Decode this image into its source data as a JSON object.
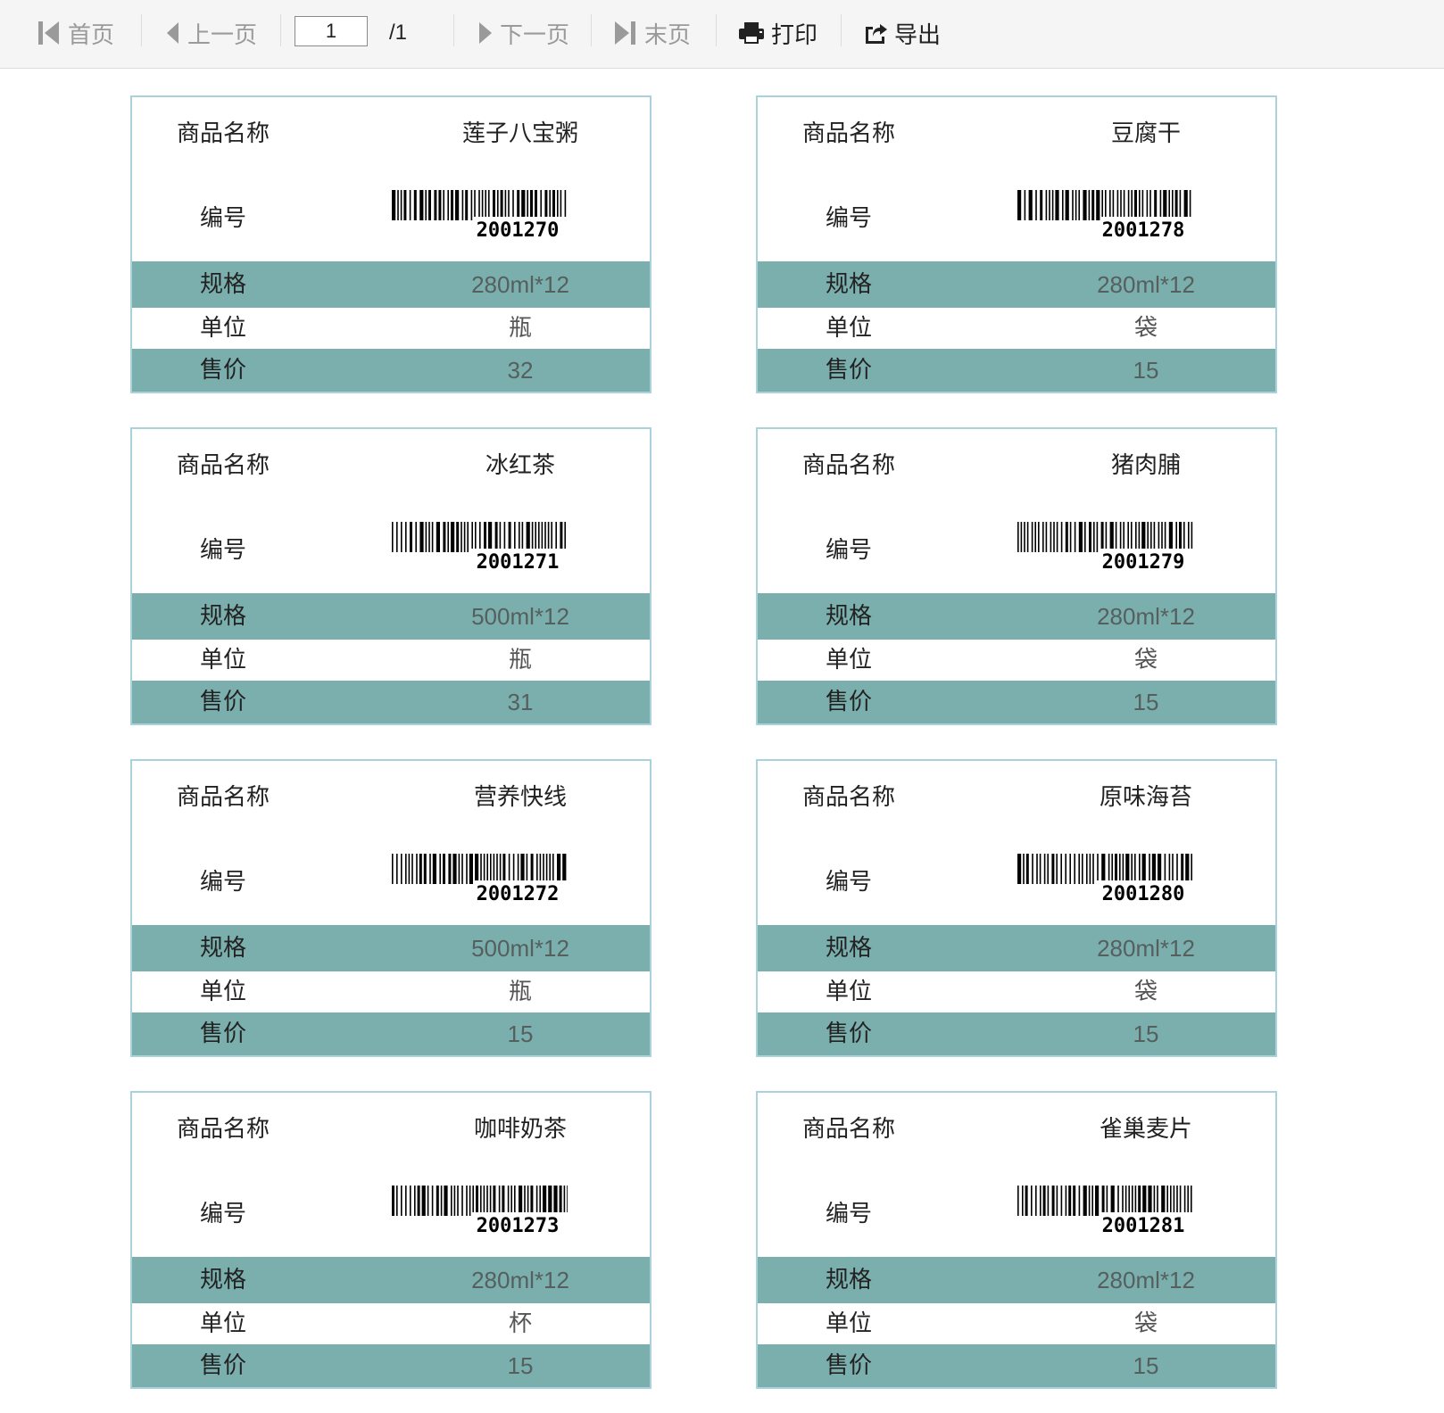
{
  "toolbar": {
    "first_label": "首页",
    "prev_label": "上一页",
    "page_value": "1",
    "page_total": "/1",
    "next_label": "下一页",
    "last_label": "末页",
    "print_label": "打印",
    "export_label": "导出",
    "icons": {
      "first": "first-page-icon",
      "prev": "prev-page-icon",
      "next": "next-page-icon",
      "last": "last-page-icon",
      "print": "printer-icon",
      "export": "export-icon"
    }
  },
  "labels": {
    "name": "商品名称",
    "code": "编号",
    "spec": "规格",
    "unit": "单位",
    "price": "售价"
  },
  "colors": {
    "stripe": "#7aafad",
    "card_border": "#a9d2dc",
    "disabled_text": "#9a9a9a"
  },
  "products": [
    {
      "name": "莲子八宝粥",
      "code": "2001270",
      "spec": "280ml*12",
      "unit": "瓶",
      "price": "32"
    },
    {
      "name": "豆腐干",
      "code": "2001278",
      "spec": "280ml*12",
      "unit": "袋",
      "price": "15"
    },
    {
      "name": "冰红茶",
      "code": "2001271",
      "spec": "500ml*12",
      "unit": "瓶",
      "price": "31"
    },
    {
      "name": "猪肉脯",
      "code": "2001279",
      "spec": "280ml*12",
      "unit": "袋",
      "price": "15"
    },
    {
      "name": "营养快线",
      "code": "2001272",
      "spec": "500ml*12",
      "unit": "瓶",
      "price": "15"
    },
    {
      "name": "原味海苔",
      "code": "2001280",
      "spec": "280ml*12",
      "unit": "袋",
      "price": "15"
    },
    {
      "name": "咖啡奶茶",
      "code": "2001273",
      "spec": "280ml*12",
      "unit": "杯",
      "price": "15"
    },
    {
      "name": "雀巢麦片",
      "code": "2001281",
      "spec": "280ml*12",
      "unit": "袋",
      "price": "15"
    }
  ]
}
